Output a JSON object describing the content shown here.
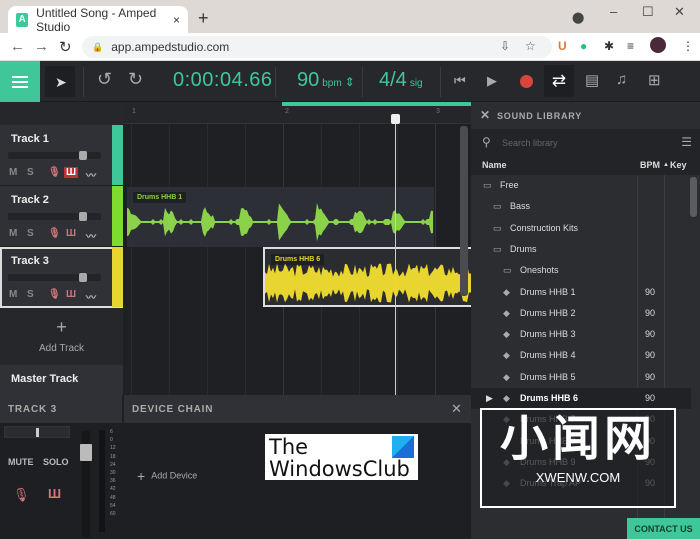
{
  "browser": {
    "tab_title": "Untitled Song - Amped Studio",
    "favicon": "A",
    "url": "app.ampedstudio.com",
    "new_tab": "+",
    "tab_close": "×",
    "min": "–",
    "max": "☐",
    "close": "✕"
  },
  "toolbar": {
    "timecode": "0:00:04.66",
    "bpm": "90",
    "bpm_unit": "bpm",
    "sig": "4/4",
    "sig_unit": "sig"
  },
  "tracks": [
    {
      "name": "Track 1",
      "color": "#3fc79a",
      "volume": 0.85
    },
    {
      "name": "Track 2",
      "color": "#7ddc2e",
      "volume": 0.85
    },
    {
      "name": "Track 3",
      "color": "#e8d530",
      "volume": 0.85
    }
  ],
  "track_controls": {
    "mute": "M",
    "solo": "S"
  },
  "add_track": "Add Track",
  "master_track": "Master Track",
  "ruler": [
    "1",
    "2",
    "3"
  ],
  "clips": [
    {
      "name": "Drums HHB 1",
      "color": "#8bd24a"
    },
    {
      "name": "Drums HHB 6",
      "color": "#e8d530"
    }
  ],
  "inspector": {
    "title": "TRACK 3",
    "mute": "MUTE",
    "solo": "SOLO",
    "scale": [
      "6",
      "0",
      "12",
      "18",
      "24",
      "30",
      "36",
      "42",
      "48",
      "54",
      "60"
    ]
  },
  "device_chain": {
    "title": "DEVICE CHAIN",
    "add": "Add Device"
  },
  "logo": {
    "line1": "The",
    "line2": "WindowsClub"
  },
  "library": {
    "title": "SOUND LIBRARY",
    "search_placeholder": "Search library",
    "col_name": "Name",
    "col_bpm": "BPM",
    "col_key": "Key",
    "rows": [
      {
        "name": "Free",
        "type": "folder",
        "level": 0,
        "bpm": ""
      },
      {
        "name": "Bass",
        "type": "folder",
        "level": 1,
        "bpm": ""
      },
      {
        "name": "Construction Kits",
        "type": "folder",
        "level": 1,
        "bpm": ""
      },
      {
        "name": "Drums",
        "type": "folder",
        "level": 1,
        "bpm": ""
      },
      {
        "name": "Oneshots",
        "type": "folder",
        "level": 2,
        "bpm": ""
      },
      {
        "name": "Drums HHB 1",
        "type": "audio",
        "level": 2,
        "bpm": "90"
      },
      {
        "name": "Drums HHB 2",
        "type": "audio",
        "level": 2,
        "bpm": "90"
      },
      {
        "name": "Drums HHB 3",
        "type": "audio",
        "level": 2,
        "bpm": "90"
      },
      {
        "name": "Drums HHB 4",
        "type": "audio",
        "level": 2,
        "bpm": "90"
      },
      {
        "name": "Drums HHB 5",
        "type": "audio",
        "level": 2,
        "bpm": "90"
      },
      {
        "name": "Drums HHB 6",
        "type": "audio",
        "level": 2,
        "bpm": "90",
        "selected": true
      },
      {
        "name": "Drums HHB 7",
        "type": "audio",
        "level": 2,
        "bpm": "90"
      },
      {
        "name": "Drums HHB 8",
        "type": "audio",
        "level": 2,
        "bpm": "90"
      },
      {
        "name": "Drums HHB 9",
        "type": "audio",
        "level": 2,
        "bpm": "90"
      },
      {
        "name": "Drums Trap AP",
        "type": "audio",
        "level": 2,
        "bpm": "90"
      }
    ]
  },
  "contact": "CONTACT US",
  "watermark": {
    "big": "小闻网",
    "small": "XWENW.COM"
  }
}
